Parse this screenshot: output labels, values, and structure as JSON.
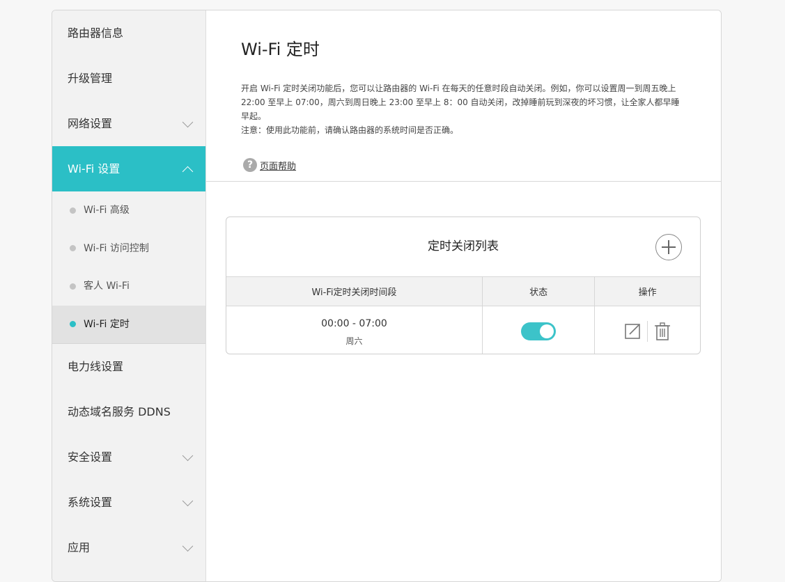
{
  "sidebar": {
    "items": [
      {
        "label": "路由器信息"
      },
      {
        "label": "升级管理"
      },
      {
        "label": "网络设置"
      },
      {
        "label": "Wi-Fi 设置"
      },
      {
        "label": "电力线设置"
      },
      {
        "label": "动态域名服务 DDNS"
      },
      {
        "label": "安全设置"
      },
      {
        "label": "系统设置"
      },
      {
        "label": "应用"
      }
    ],
    "wifi_sub_items": [
      {
        "label": "Wi-Fi 高级"
      },
      {
        "label": "Wi-Fi 访问控制"
      },
      {
        "label": "客人 Wi-Fi"
      },
      {
        "label": "Wi-Fi 定时"
      }
    ]
  },
  "main": {
    "title": "Wi-Fi 定时",
    "desc_line1": "开启 Wi-Fi 定时关闭功能后，您可以让路由器的 Wi-Fi 在每天的任意时段自动关闭。例如，你可以设置周一到周五晚上 22:00 至早上 07:00，周六到周日晚上 23:00 至早上 8：00 自动关闭，改掉睡前玩到深夜的坏习惯，让全家人都早睡早起。",
    "desc_line2": "注意：使用此功能前，请确认路由器的系统时间是否正确。",
    "help_label": "页面帮助"
  },
  "schedule_card": {
    "title": "定时关闭列表",
    "columns": [
      "Wi-Fi定时关闭时间段",
      "状态",
      "操作"
    ],
    "rows": [
      {
        "time_range": "00:00 - 07:00",
        "days": "周六",
        "enabled": true
      }
    ]
  },
  "colors": {
    "accent": "#2bbfc6",
    "toggle_on": "#3cc3c9"
  },
  "icons": {
    "add": "plus-circle-icon",
    "edit": "edit-icon",
    "delete": "trash-icon",
    "help": "question-circle-icon",
    "expand": "chevron-down-icon",
    "collapse": "chevron-up-icon"
  }
}
